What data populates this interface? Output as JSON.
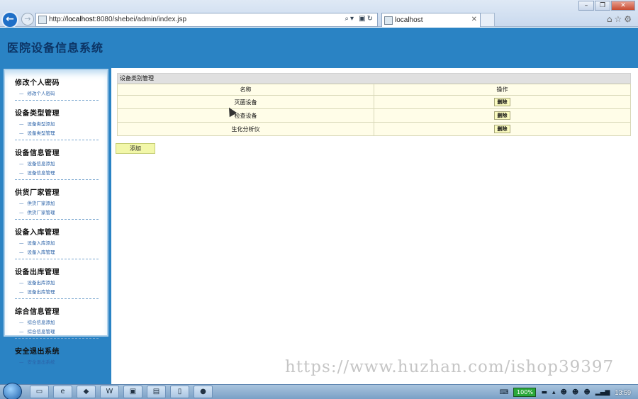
{
  "browser": {
    "url_prefix": "http://",
    "url_host": "localhost",
    "url_rest": ":8080/shebei/admin/index.jsp",
    "tab_title": "localhost",
    "window_controls": [
      "minimize-icon",
      "restore-icon",
      "close-icon"
    ]
  },
  "site": {
    "title": "医院设备信息系统"
  },
  "sidebar": {
    "groups": [
      {
        "title": "修改个人密码",
        "items": [
          "修改个人密码"
        ]
      },
      {
        "title": "设备类型管理",
        "items": [
          "设备类型添加",
          "设备类型管理"
        ]
      },
      {
        "title": "设备信息管理",
        "items": [
          "设备信息添加",
          "设备信息管理"
        ]
      },
      {
        "title": "供货厂家管理",
        "items": [
          "供货厂家添加",
          "供货厂家管理"
        ]
      },
      {
        "title": "设备入库管理",
        "items": [
          "设备入库添加",
          "设备入库管理"
        ]
      },
      {
        "title": "设备出库管理",
        "items": [
          "设备出库添加",
          "设备出库管理"
        ]
      },
      {
        "title": "综合信息管理",
        "items": [
          "综合信息添加",
          "综合信息管理"
        ]
      },
      {
        "title": "安全退出系统",
        "items": [
          "安全退出系统"
        ]
      }
    ]
  },
  "main": {
    "panel_title": "设备类别管理",
    "columns": [
      "名称",
      "操作"
    ],
    "rows": [
      {
        "name": "灭菌设备",
        "action": "删除"
      },
      {
        "name": "检查设备",
        "action": "删除"
      },
      {
        "name": "生化分析仪",
        "action": "删除"
      }
    ],
    "add_label": "添加"
  },
  "watermark": "https://www.huzhan.com/ishop39397",
  "taskbar": {
    "apps": [
      "folder-icon",
      "ie-icon",
      "app-icon",
      "word-icon",
      "toolbox-icon",
      "network-icon",
      "notepad-icon",
      "app2-icon"
    ],
    "battery": "100%",
    "clock": "13:59"
  },
  "colors": {
    "header_bg": "#2a83c4",
    "title_text": "#0c3465",
    "table_bg": "#fffde8",
    "button_bg": "#fbfbbf"
  }
}
